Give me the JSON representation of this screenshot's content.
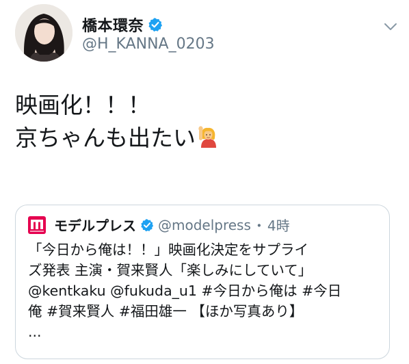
{
  "author": {
    "display_name": "橋本環奈",
    "handle": "@H_KANNA_0203",
    "avatar_icon": "profile-photo"
  },
  "tweet": {
    "lines": [
      "映画化！！！",
      "京ちゃんも出たい"
    ],
    "emoji_icon": "person-raising-hand-emoji"
  },
  "quoted_tweet": {
    "logo_icon": "modelpress-logo",
    "display_name": "モデルプレス",
    "handle": "@modelpress",
    "separator": "・",
    "time": "4時",
    "lines": [
      "「今日から俺は！！」映画化決定をサプライ",
      "ズ発表 主演・賀来賢人「楽しみにしていて」",
      "@kentkaku @fukuda_u1 #今日から俺は #今日",
      "俺 #賀来賢人 #福田雄一 【ほか写真あり】",
      "..."
    ]
  },
  "colors": {
    "verified_blue": "#1da1f2",
    "secondary_text": "#657786",
    "border": "#ccd6dd",
    "logo_red": "#e5004f"
  }
}
